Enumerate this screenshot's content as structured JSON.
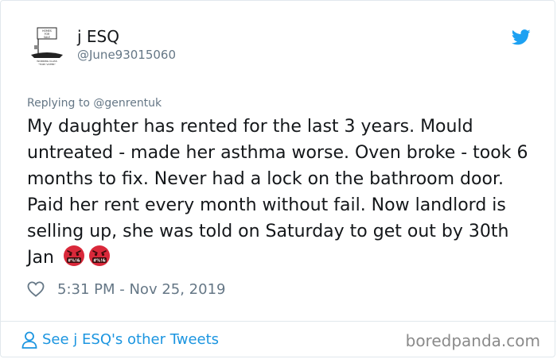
{
  "tweet": {
    "author_name": "j ESQ",
    "author_handle": "@June93015060",
    "replying_to": "Replying to @genrentuk",
    "text": "My daughter has rented for the last 3 years. Mould untreated - made her asthma worse. Oven broke - took 6 months to fix. Never had a lock on the bathroom door. Paid her rent every month without fail. Now landlord is selling up, she was told on Saturday to get out by 30th Jan",
    "emojis": [
      "face-with-symbols-on-mouth",
      "face-with-symbols-on-mouth"
    ],
    "emoji_glyph_text": "#%!&",
    "timestamp": "5:31 PM - Nov 25, 2019"
  },
  "avatar": {
    "sign_text": "HOMES FOR SALE",
    "caption": "WORKING CLASS \"TORY VOTER\""
  },
  "footer": {
    "see_more": "See j ESQ's other Tweets",
    "watermark": "boredpanda.com"
  },
  "colors": {
    "link_blue": "#1b95e0",
    "twitter_blue": "#1da1f2",
    "secondary_text": "#657786",
    "emoji_red": "#d9283a"
  }
}
